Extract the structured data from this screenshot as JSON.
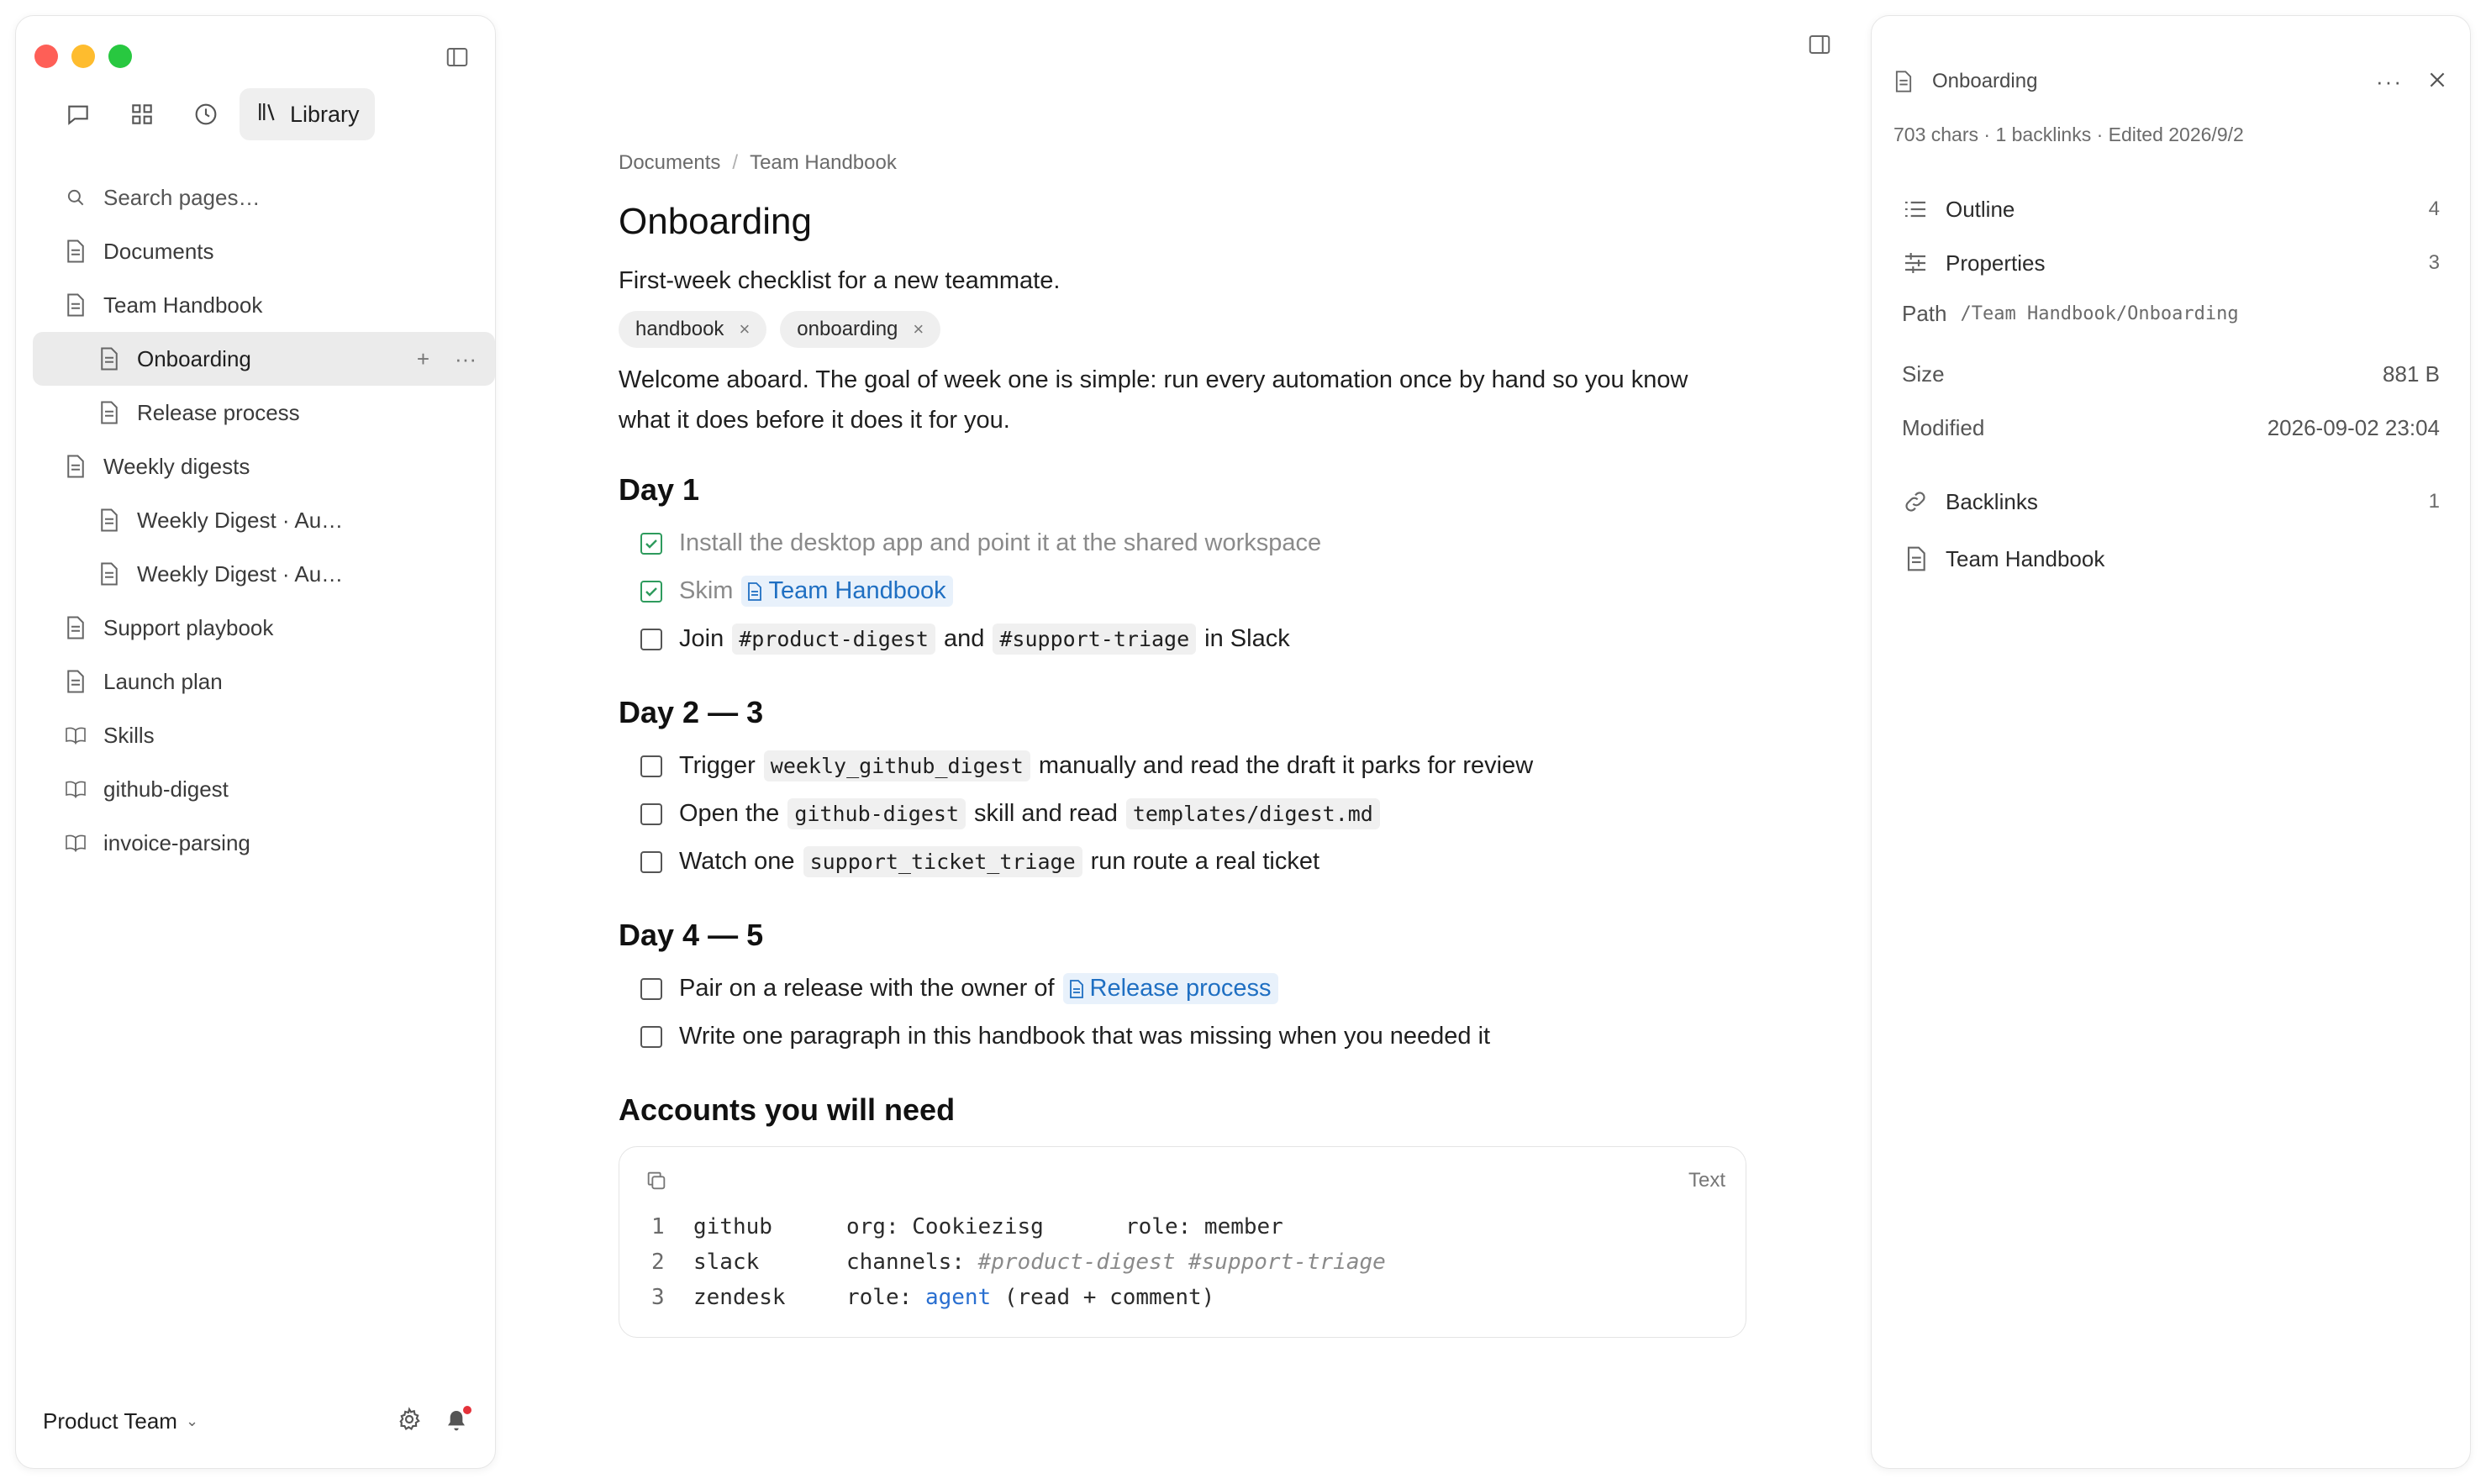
{
  "sidebar": {
    "library_label": "Library",
    "search_placeholder": "Search pages…",
    "items": [
      {
        "label": "Documents"
      },
      {
        "label": "Team Handbook"
      },
      {
        "label": "Onboarding"
      },
      {
        "label": "Release process"
      },
      {
        "label": "Weekly digests"
      },
      {
        "label": "Weekly Digest · Au…"
      },
      {
        "label": "Weekly Digest · Au…"
      },
      {
        "label": "Support playbook"
      },
      {
        "label": "Launch plan"
      },
      {
        "label": "Skills"
      },
      {
        "label": "github-digest"
      },
      {
        "label": "invoice-parsing"
      }
    ],
    "active_actions": {
      "add": "+",
      "more": "···"
    },
    "team": "Product Team"
  },
  "main": {
    "breadcrumb": [
      "Documents",
      "/",
      "Team Handbook"
    ],
    "title": "Onboarding",
    "subtitle": "First-week checklist for a new teammate.",
    "tags": [
      "handbook",
      "onboarding"
    ],
    "tag_remove": "×",
    "intro": "Welcome aboard. The goal of week one is simple: run every automation once by hand so you know what it does before it does it for you.",
    "day1": {
      "heading": "Day 1",
      "items": {
        "i1": "Install the desktop app and point it at the shared workspace",
        "i2_pre": "Skim",
        "i2_link": "Team Handbook",
        "i3_pre": "Join",
        "i3_code1": "#product-digest",
        "i3_mid": "and",
        "i3_code2": "#support-triage",
        "i3_post": "in Slack"
      }
    },
    "day2": {
      "heading": "Day 2 — 3",
      "items": {
        "i1_pre": "Trigger",
        "i1_code": "weekly_github_digest",
        "i1_post": "manually and read the draft it parks for review",
        "i2_pre": "Open the",
        "i2_code1": "github-digest",
        "i2_mid": "skill and read",
        "i2_code2": "templates/digest.md",
        "i3_pre": "Watch one",
        "i3_code": "support_ticket_triage",
        "i3_post": "run route a real ticket"
      }
    },
    "day4": {
      "heading": "Day 4 — 5",
      "items": {
        "i1_pre": "Pair on a release with the owner of",
        "i1_link": "Release process",
        "i2": "Write one paragraph in this handbook that was missing when you needed it"
      }
    },
    "accounts": {
      "heading": "Accounts you will need",
      "lang": "Text",
      "lines": [
        {
          "n": "1",
          "key": "github",
          "v1": "org: Cookiezisg",
          "v2": "role: member"
        },
        {
          "n": "2",
          "key": "slack",
          "v1_label": "channels:",
          "v1_comment": "#product-digest #support-triage"
        },
        {
          "n": "3",
          "key": "zendesk",
          "v1_label": "role:",
          "v1_kw": "agent",
          "v1_rest": "(read + comment)"
        }
      ]
    }
  },
  "panel": {
    "title": "Onboarding",
    "more": "···",
    "meta": "703 chars · 1 backlinks · Edited 2026/9/2",
    "outline": {
      "label": "Outline",
      "count": "4"
    },
    "properties": {
      "label": "Properties",
      "count": "3"
    },
    "path": {
      "label": "Path",
      "value": "/Team Handbook/Onboarding"
    },
    "size": {
      "label": "Size",
      "value": "881 B"
    },
    "modified": {
      "label": "Modified",
      "value": "2026-09-02 23:04"
    },
    "backlinks": {
      "label": "Backlinks",
      "count": "1"
    },
    "backlink_items": [
      "Team Handbook"
    ]
  }
}
